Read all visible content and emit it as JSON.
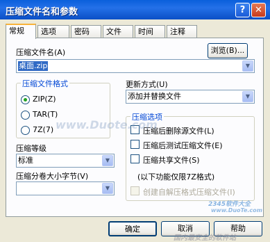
{
  "window": {
    "title": "压缩文件名和参数",
    "help_glyph": "?",
    "close_glyph": "✕"
  },
  "tabs": [
    "常规",
    "选项",
    "密码",
    "文件",
    "时间",
    "注释"
  ],
  "archive_name": {
    "label": "压缩文件名(A)",
    "value": "桌面.zip",
    "browse_label": "浏览(B)..."
  },
  "update_mode": {
    "label": "更新方式(U)",
    "value": "添加并替换文件"
  },
  "format": {
    "legend": "压缩文件格式",
    "options": [
      {
        "label": "ZIP(Z)",
        "selected": true
      },
      {
        "label": "TAR(T)",
        "selected": false
      },
      {
        "label": "7Z(7)",
        "selected": false
      }
    ]
  },
  "compression_options": {
    "legend": "压缩选项",
    "items": [
      {
        "label": "压缩后删除源文件(L)",
        "checked": false,
        "enabled": true
      },
      {
        "label": "压缩后测试压缩文件(E)",
        "checked": false,
        "enabled": true
      },
      {
        "label": "压缩共享文件(S)",
        "checked": false,
        "enabled": true
      }
    ],
    "note": "(以下功能仅限7Z格式)",
    "sfx": {
      "label": "创建自解压格式压缩文件(I)",
      "checked": false,
      "enabled": false
    }
  },
  "level": {
    "label": "压缩等级",
    "value": "标准"
  },
  "volume": {
    "label": "压缩分卷大小字节(V)",
    "value": ""
  },
  "buttons": {
    "ok": "确定",
    "cancel": "取消",
    "help": "帮助"
  },
  "watermarks": {
    "center": "www.Duote.com",
    "brand": "2345软件大全",
    "brand_url": "www.DuoTe.com",
    "bottom": "国内最安全的软件站"
  }
}
